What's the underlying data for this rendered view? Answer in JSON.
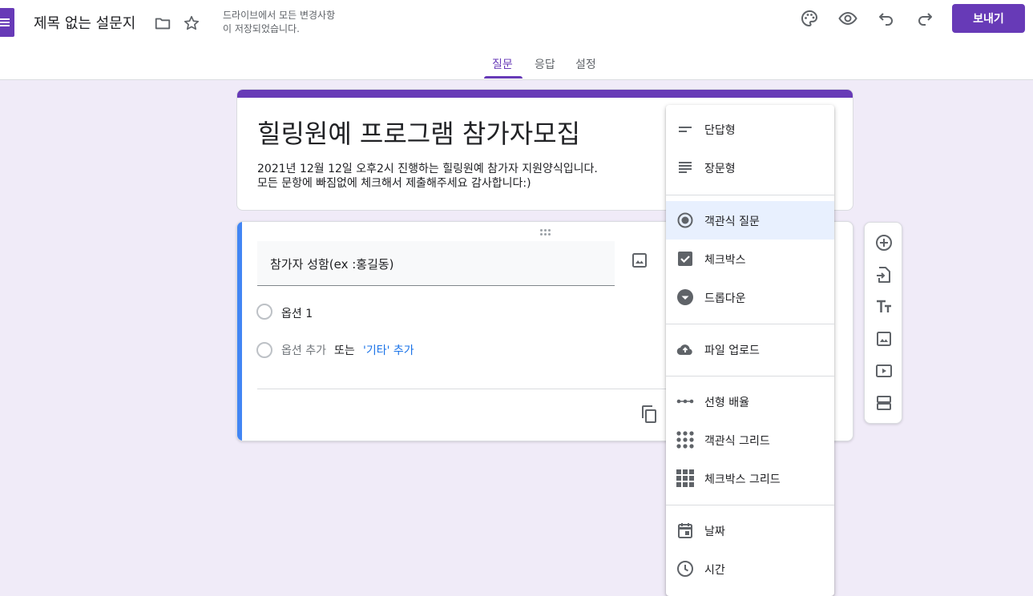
{
  "header": {
    "title": "제목 없는 설문지",
    "save_status_line1": "드라이브에서 모든 변경사항",
    "save_status_line2": "이 저장되었습니다.",
    "send_label": "보내기",
    "brand_color": "#673ab7",
    "icons": [
      "folder-icon",
      "star-icon",
      "palette-icon",
      "preview-eye-icon",
      "undo-icon",
      "redo-icon"
    ]
  },
  "tabs": [
    {
      "label": "질문",
      "active": true
    },
    {
      "label": "응답",
      "active": false
    },
    {
      "label": "설정",
      "active": false
    }
  ],
  "form": {
    "title": "힐링원예 프로그램 참가자모집",
    "description_line1": "2021년 12월 12일 오후2시 진행하는 힐링원예 참가자 지원양식입니다.",
    "description_line2": "모든 문항에 빠짐없에 체크해서 제출해주세요 감사합니다:)"
  },
  "question": {
    "title": "참가자 성함(ex :홍길동)",
    "option1": "옵션 1",
    "add_option": "옵션 추가",
    "or_text": "또는",
    "add_other": "'기타' 추가"
  },
  "menu": {
    "items": [
      {
        "label": "단답형",
        "icon": "short-answer-icon"
      },
      {
        "label": "장문형",
        "icon": "paragraph-icon"
      },
      {
        "label": "객관식 질문",
        "icon": "radio-button-icon",
        "selected": true
      },
      {
        "label": "체크박스",
        "icon": "checkbox-icon"
      },
      {
        "label": "드롭다운",
        "icon": "dropdown-icon"
      },
      {
        "label": "파일 업로드",
        "icon": "cloud-upload-icon"
      },
      {
        "label": "선형 배율",
        "icon": "linear-scale-icon"
      },
      {
        "label": "객관식 그리드",
        "icon": "dot-grid-icon"
      },
      {
        "label": "체크박스 그리드",
        "icon": "checkbox-grid-icon"
      },
      {
        "label": "날짜",
        "icon": "calendar-icon"
      },
      {
        "label": "시간",
        "icon": "clock-icon"
      }
    ]
  },
  "toolbar": {
    "icons": [
      "add-question-icon",
      "import-questions-icon",
      "add-title-icon",
      "add-image-icon",
      "add-video-icon",
      "add-section-icon"
    ]
  }
}
